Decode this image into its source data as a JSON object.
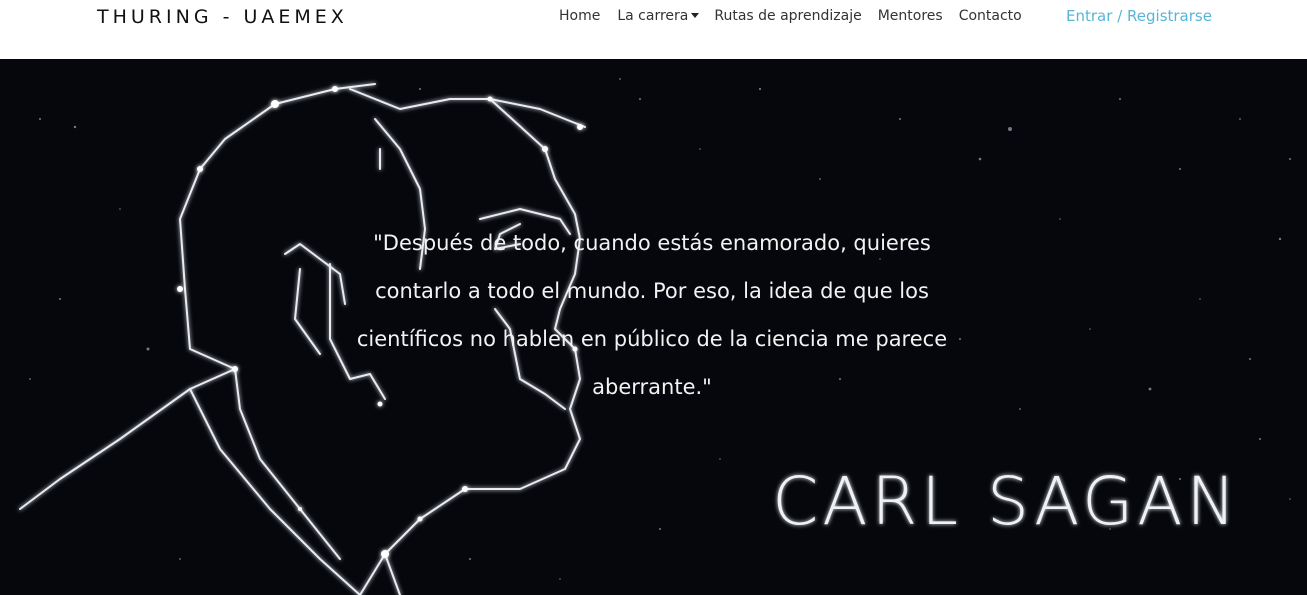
{
  "brand": "THURING - UAEMEX",
  "nav": {
    "home": "Home",
    "la_carrera": "La carrera",
    "rutas": "Rutas de aprendizaje",
    "mentores": "Mentores",
    "contacto": "Contacto"
  },
  "auth": {
    "entrar": "Entrar",
    "separator": "/",
    "registrarse": "Registrarse"
  },
  "hero": {
    "quote": "\"Después de todo, cuando estás enamorado, quieres contarlo a todo el mundo. Por eso, la idea de que los científicos no hablen en público de la ciencia me parece aberrante.\"",
    "image_title": "CARL SAGAN"
  },
  "colors": {
    "accent": "#56b6d8",
    "hero_bg": "#05070c",
    "text_dark": "#111111"
  }
}
